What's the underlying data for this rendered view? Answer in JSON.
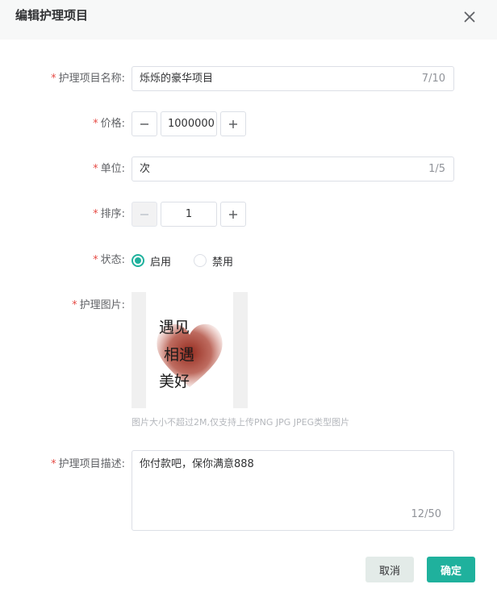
{
  "dialog": {
    "title": "编辑护理项目",
    "close_icon": "close-icon"
  },
  "form": {
    "name": {
      "required_mark": "*",
      "label": "护理项目名称:",
      "value": "烁烁的豪华项目",
      "counter": "7/10"
    },
    "price": {
      "required_mark": "*",
      "label": "价格:",
      "value": "1000000",
      "minus": "−",
      "plus": "+"
    },
    "unit": {
      "required_mark": "*",
      "label": "单位:",
      "value": "次",
      "counter": "1/5"
    },
    "sort": {
      "required_mark": "*",
      "label": "排序:",
      "value": "1",
      "minus": "−",
      "plus": "+",
      "minus_disabled": true
    },
    "status": {
      "required_mark": "*",
      "label": "状态:",
      "options": [
        {
          "label": "启用",
          "checked": true
        },
        {
          "label": "禁用",
          "checked": false
        }
      ]
    },
    "image": {
      "required_mark": "*",
      "label": "护理图片:",
      "handwriting": [
        "遇见",
        "相遇",
        "美好"
      ],
      "hint": "图片大小不超过2M,仅支持上传PNG JPG JPEG类型图片"
    },
    "description": {
      "required_mark": "*",
      "label": "护理项目描述:",
      "value": "你付款吧，保你满意888",
      "counter": "12/50"
    }
  },
  "footer": {
    "cancel_label": "取消",
    "confirm_label": "确定"
  },
  "colors": {
    "accent": "#1fb19d",
    "required": "#e64b45",
    "cancel_bg": "#e3ebe8"
  }
}
